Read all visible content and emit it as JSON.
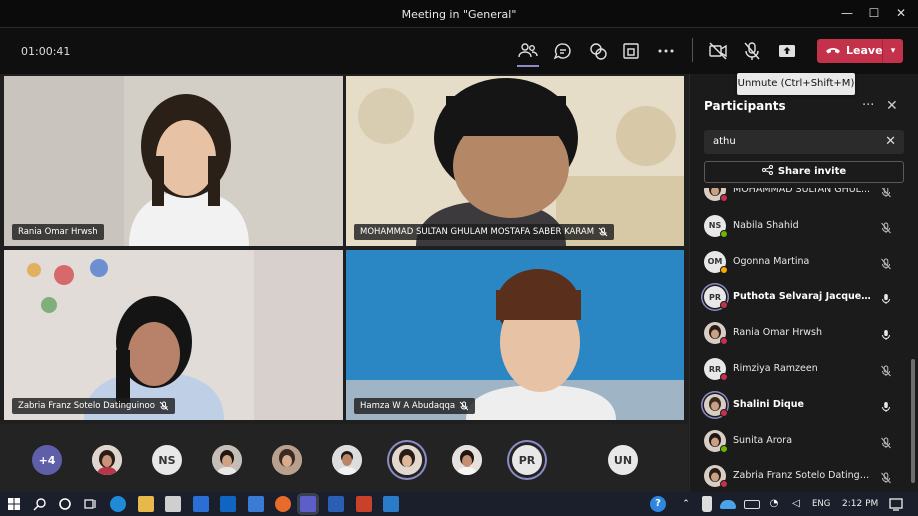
{
  "window": {
    "title": "Meeting in \"General\"",
    "minimize": "—",
    "maximize": "☐",
    "close": "✕"
  },
  "toolbar": {
    "timer": "01:00:41",
    "leave_label": "Leave",
    "leave_dropdown": "▾",
    "tooltip": "Unmute (Ctrl+Shift+M)",
    "icons": [
      "participants-icon",
      "chat-icon",
      "reactions-icon",
      "share-tray-icon",
      "more-icon",
      "camera-off-icon",
      "mic-off-icon",
      "share-content-icon"
    ]
  },
  "videos": [
    {
      "name": "Rania Omar Hrwsh",
      "muted": false
    },
    {
      "name": "MOHAMMAD SULTAN GHULAM MOSTAFA SABER KARAM",
      "muted": true
    },
    {
      "name": "Zabria Franz Sotelo Datinguinoo",
      "muted": true
    },
    {
      "name": "Hamza W A Abudaqqa",
      "muted": true
    }
  ],
  "strip": [
    {
      "label": "+4",
      "type": "count"
    },
    {
      "label": "",
      "type": "photo"
    },
    {
      "label": "NS",
      "type": "initials"
    },
    {
      "label": "",
      "type": "photo"
    },
    {
      "label": "",
      "type": "photo"
    },
    {
      "label": "",
      "type": "photo"
    },
    {
      "label": "",
      "type": "photo",
      "ring": true
    },
    {
      "label": "",
      "type": "photo"
    },
    {
      "label": "PR",
      "type": "initials",
      "ring": true
    },
    {
      "label": "UN",
      "type": "initials"
    }
  ],
  "participants": {
    "title": "Participants",
    "more": "···",
    "close": "✕",
    "search_value": "athu",
    "search_clear": "✕",
    "share_invite": "Share invite",
    "list": [
      {
        "name": "MOHAMMAD SULTAN GHUL...",
        "initials": "",
        "photo": true,
        "muted": true,
        "bold": false,
        "status": "red"
      },
      {
        "name": "Nabila Shahid",
        "initials": "NS",
        "photo": false,
        "muted": true,
        "bold": false,
        "status": "green"
      },
      {
        "name": "Ogonna Martina",
        "initials": "OM",
        "photo": false,
        "muted": true,
        "bold": false,
        "status": "orange"
      },
      {
        "name": "Puthota Selvaraj Jacqueline ...",
        "initials": "PR",
        "photo": false,
        "muted": false,
        "bold": true,
        "status": "red",
        "ring": true
      },
      {
        "name": "Rania Omar Hrwsh",
        "initials": "",
        "photo": true,
        "muted": false,
        "bold": false,
        "status": "red"
      },
      {
        "name": "Rimziya Ramzeen",
        "initials": "RR",
        "photo": false,
        "muted": true,
        "bold": false,
        "status": "red"
      },
      {
        "name": "Shalini Dique",
        "initials": "",
        "photo": true,
        "muted": false,
        "bold": true,
        "status": "red",
        "ring": true
      },
      {
        "name": "Sunita Arora",
        "initials": "",
        "photo": true,
        "muted": true,
        "bold": false,
        "status": "green"
      },
      {
        "name": "Zabria Franz Sotelo Datinguin...",
        "initials": "",
        "photo": true,
        "muted": true,
        "bold": false,
        "status": "red"
      }
    ]
  },
  "taskbar": {
    "clock": "2:12 PM",
    "lang": "ENG",
    "help_badge": "?"
  },
  "colors": {
    "leave": "#c4314b",
    "accent": "#8b8cc7",
    "initials_bg": "#e8e8e8"
  }
}
